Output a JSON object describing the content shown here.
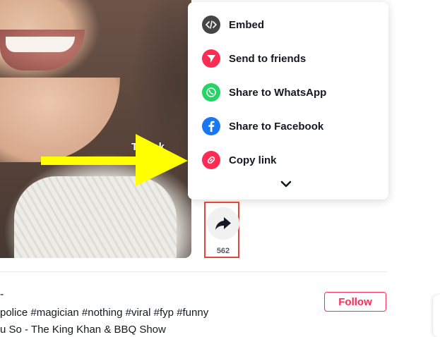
{
  "video": {
    "watermark": "TikTok"
  },
  "share_menu": {
    "items": [
      {
        "label": "Embed",
        "icon": "embed-icon",
        "color": "#454545"
      },
      {
        "label": "Send to friends",
        "icon": "send-icon",
        "color": "#fe2c55"
      },
      {
        "label": "Share to WhatsApp",
        "icon": "whatsapp-icon",
        "color": "#25d366"
      },
      {
        "label": "Share to Facebook",
        "icon": "facebook-icon",
        "color": "#1877f2"
      },
      {
        "label": "Copy link",
        "icon": "link-icon",
        "color": "#fe2c55"
      }
    ],
    "expand_icon": "chevron-down-icon"
  },
  "share_button": {
    "icon": "share-arrow-icon",
    "count": "562",
    "highlight_color": "#e3473a"
  },
  "post": {
    "dash": "-",
    "hashtags": "police #magician #nothing #viral #fyp #funny",
    "music": "u So - The King Khan & BBQ Show",
    "follow_label": "Follow",
    "accent_color": "#fe2c55"
  },
  "annotation": {
    "arrow_color": "#ffff00"
  }
}
